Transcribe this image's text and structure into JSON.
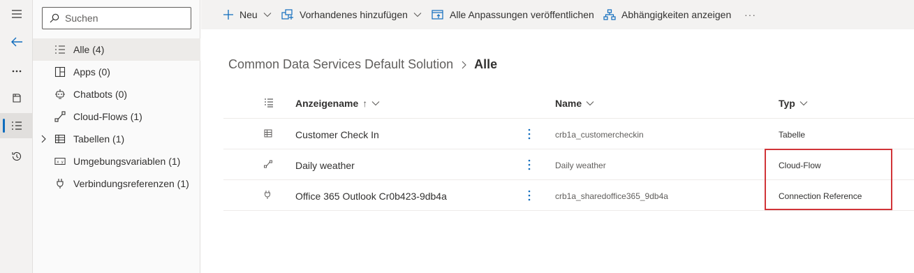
{
  "rail": {
    "items": [
      {
        "name": "menu",
        "icon": "hamburger-icon"
      },
      {
        "name": "back",
        "icon": "back-arrow-icon"
      },
      {
        "name": "more",
        "icon": "ellipsis-icon"
      },
      {
        "name": "objects",
        "icon": "library-icon"
      },
      {
        "name": "solution-list",
        "icon": "list-icon"
      },
      {
        "name": "history",
        "icon": "history-icon"
      }
    ],
    "accent": "#0f6cbd"
  },
  "nav": {
    "search_placeholder": "Suchen",
    "items": [
      {
        "label": "Alle",
        "count": "(4)",
        "icon": "all-list-icon",
        "selected": true
      },
      {
        "label": "Apps",
        "count": "(0)",
        "icon": "apps-icon"
      },
      {
        "label": "Chatbots",
        "count": "(0)",
        "icon": "chatbot-icon"
      },
      {
        "label": "Cloud-Flows",
        "count": "(1)",
        "icon": "flow-icon"
      },
      {
        "label": "Tabellen",
        "count": "(1)",
        "icon": "table-icon",
        "expandable": true
      },
      {
        "label": "Umgebungsvariablen",
        "count": "(1)",
        "icon": "variable-icon"
      },
      {
        "label": "Verbindungsreferenzen",
        "count": "(1)",
        "icon": "plug-icon"
      }
    ]
  },
  "toolbar": {
    "new_label": "Neu",
    "add_existing_label": "Vorhandenes hinzufügen",
    "publish_label": "Alle Anpassungen veröffentlichen",
    "dependencies_label": "Abhängigkeiten anzeigen",
    "more_label": "···"
  },
  "breadcrumb": {
    "parent": "Common Data Services Default Solution",
    "current": "Alle"
  },
  "grid": {
    "columns": {
      "display_name": "Anzeigename",
      "sort_indicator": "↑",
      "name": "Name",
      "type": "Typ"
    },
    "rows": [
      {
        "icon": "table-icon",
        "display_name": "Customer Check In",
        "name": "crb1a_customercheckin",
        "type": "Tabelle"
      },
      {
        "icon": "flow-icon",
        "display_name": "Daily weather",
        "name": "Daily weather",
        "type": "Cloud-Flow"
      },
      {
        "icon": "plug-icon",
        "display_name": "Office 365 Outlook Cr0b423-9db4a",
        "name": "crb1a_sharedoffice365_9db4a",
        "type": "Connection Reference"
      }
    ]
  },
  "colors": {
    "highlight": "#d13438",
    "primary_icon": "#0f6cbd"
  }
}
